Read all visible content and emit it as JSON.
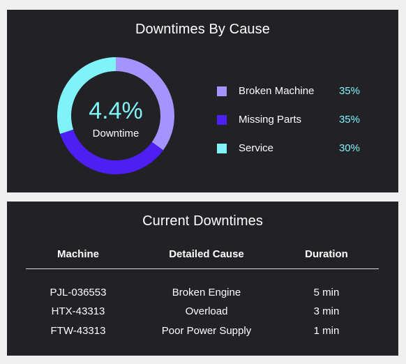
{
  "downtimes_by_cause": {
    "title": "Downtimes By Cause",
    "center_value": "4.4%",
    "center_label": "Downtime",
    "slices": [
      {
        "label": "Broken Machine",
        "percent_label": "35%",
        "value": 35,
        "color": "#a593fe"
      },
      {
        "label": "Missing Parts",
        "percent_label": "35%",
        "value": 35,
        "color": "#4d1ff2"
      },
      {
        "label": "Service",
        "percent_label": "30%",
        "value": 30,
        "color": "#7ff3f8"
      }
    ]
  },
  "current_downtimes": {
    "title": "Current Downtimes",
    "headers": {
      "machine": "Machine",
      "cause": "Detailed Cause",
      "duration": "Duration"
    },
    "rows": [
      {
        "machine": "PJL-036553",
        "cause": "Broken Engine",
        "duration": "5 min"
      },
      {
        "machine": "HTX-43313",
        "cause": "Overload",
        "duration": "3 min"
      },
      {
        "machine": "FTW-43313",
        "cause": "Poor Power Supply",
        "duration": "1 min"
      }
    ]
  },
  "colors": {
    "panel_bg": "#222226",
    "page_bg": "#efefef",
    "accent_cyan": "#7ff3f8"
  },
  "chart_data": {
    "type": "pie",
    "title": "Downtimes By Cause",
    "categories": [
      "Broken Machine",
      "Missing Parts",
      "Service"
    ],
    "values": [
      35,
      35,
      30
    ],
    "colors": [
      "#a593fe",
      "#4d1ff2",
      "#7ff3f8"
    ],
    "center_text": "4.4%",
    "center_subtext": "Downtime",
    "legend_position": "right"
  }
}
